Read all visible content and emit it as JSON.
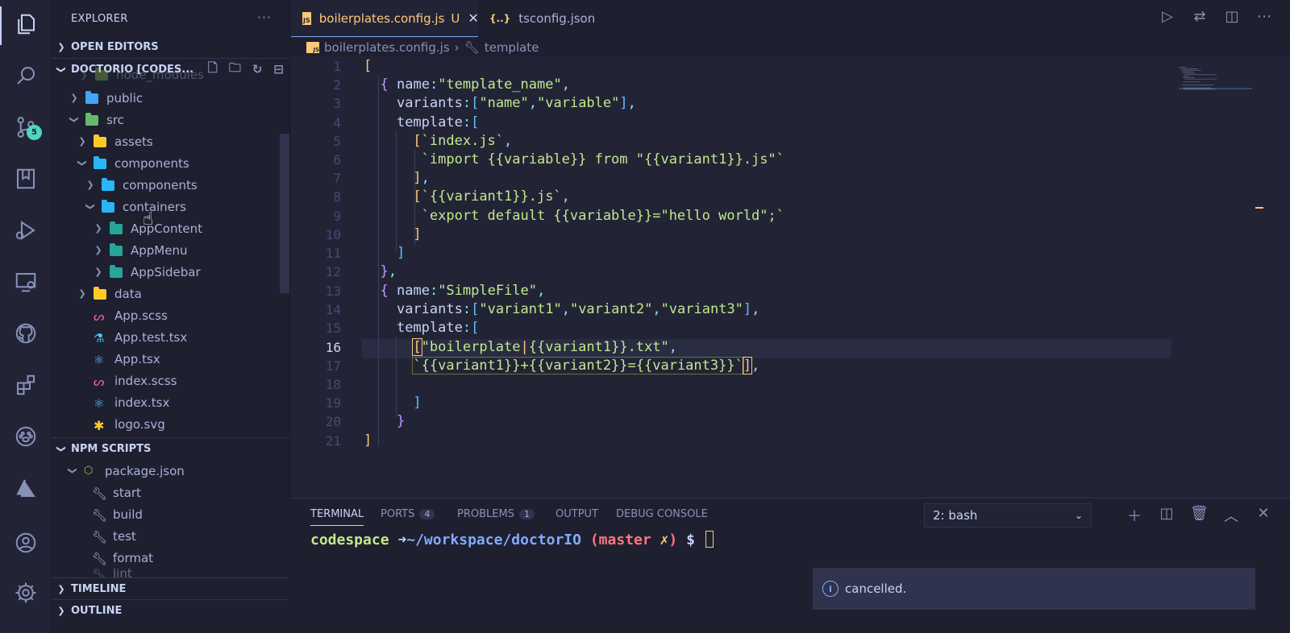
{
  "activity_bar": {
    "items": [
      "explorer-icon",
      "search-icon",
      "source-control-icon",
      "bookmark-icon",
      "run-debug-icon",
      "remote-explorer-icon",
      "github-icon",
      "extensions-icon",
      "paw-icon",
      "azure-icon",
      "account-icon",
      "settings-gear-icon"
    ],
    "source_control_badge": "5"
  },
  "sidebar": {
    "title": "EXPLORER",
    "more": "···",
    "sections": {
      "open_editors": "OPEN EDITORS",
      "workspace": "DOCTORIO [CODES...",
      "npm_scripts": "NPM SCRIPTS",
      "timeline": "TIMELINE",
      "outline": "OUTLINE"
    },
    "tree": [
      {
        "label": "node_modules",
        "type": "folder"
      },
      {
        "label": "public",
        "type": "folder"
      },
      {
        "label": "src",
        "type": "folder"
      },
      {
        "label": "assets",
        "type": "folder"
      },
      {
        "label": "components",
        "type": "folder"
      },
      {
        "label": "components",
        "type": "folder"
      },
      {
        "label": "containers",
        "type": "folder"
      },
      {
        "label": "AppContent",
        "type": "folder"
      },
      {
        "label": "AppMenu",
        "type": "folder"
      },
      {
        "label": "AppSidebar",
        "type": "folder"
      },
      {
        "label": "data",
        "type": "folder"
      },
      {
        "label": "App.scss",
        "type": "file"
      },
      {
        "label": "App.test.tsx",
        "type": "file"
      },
      {
        "label": "App.tsx",
        "type": "file"
      },
      {
        "label": "index.scss",
        "type": "file"
      },
      {
        "label": "index.tsx",
        "type": "file"
      },
      {
        "label": "logo.svg",
        "type": "file"
      }
    ],
    "npm": {
      "package": "package.json",
      "scripts": [
        "start",
        "build",
        "test",
        "format",
        "lint"
      ]
    }
  },
  "editor": {
    "tabs": [
      {
        "label": "boilerplates.config.js",
        "badge": "U",
        "icon": "JS",
        "active": true
      },
      {
        "label": "tsconfig.json",
        "icon": "{..}",
        "active": false
      }
    ],
    "breadcrumb": {
      "file": "boilerplates.config.js",
      "symbol": "template"
    },
    "current_line": 16,
    "line_count": 21
  },
  "panel": {
    "tabs": [
      {
        "label": "TERMINAL",
        "active": true
      },
      {
        "label": "PORTS",
        "count": "4"
      },
      {
        "label": "PROBLEMS",
        "count": "1"
      },
      {
        "label": "OUTPUT"
      },
      {
        "label": "DEBUG CONSOLE"
      }
    ],
    "terminal_select": "2: bash",
    "prompt": {
      "host": "codespace",
      "arrow": "➜",
      "path": "~/workspace/doctorIO",
      "branch": "master",
      "dirty": "✗",
      "dollar": "$"
    }
  },
  "notification": {
    "text": "cancelled.",
    "icon": "info-icon"
  }
}
